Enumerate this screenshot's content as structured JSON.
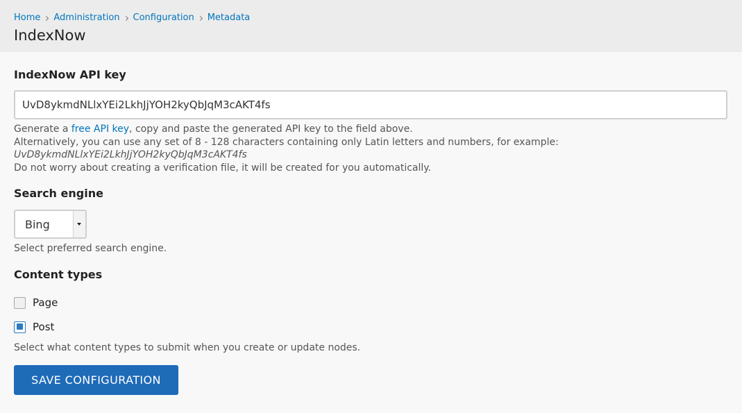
{
  "breadcrumb": [
    {
      "label": "Home"
    },
    {
      "label": "Administration"
    },
    {
      "label": "Configuration"
    },
    {
      "label": "Metadata"
    }
  ],
  "page_title": "IndexNow",
  "api_key": {
    "label": "IndexNow API key",
    "value": "UvD8ykmdNLlxYEi2LkhJjYOH2kyQbJqM3cAKT4fs",
    "desc_prefix": "Generate a ",
    "desc_link": "free API key",
    "desc_suffix": ", copy and paste the generated API key to the field above.",
    "desc_line2": "Alternatively, you can use any set of 8 - 128 characters containing only Latin letters and numbers, for example:",
    "desc_example": "UvD8ykmdNLlxYEi2LkhJjYOH2kyQbJqM3cAKT4fs",
    "desc_line4": "Do not worry about creating a verification file, it will be created for you automatically."
  },
  "search_engine": {
    "label": "Search engine",
    "selected": "Bing",
    "description": "Select preferred search engine."
  },
  "content_types": {
    "label": "Content types",
    "options": [
      {
        "label": "Page",
        "checked": false
      },
      {
        "label": "Post",
        "checked": true
      }
    ],
    "description": "Select what content types to submit when you create or update nodes."
  },
  "save_label": "SAVE CONFIGURATION",
  "colors": {
    "accent": "#1e6bb8",
    "link": "#0074bd",
    "header_bg": "#ececec"
  },
  "icons": {
    "breadcrumb_separator": "chevron-right-icon",
    "select_arrow": "caret-down-icon"
  }
}
